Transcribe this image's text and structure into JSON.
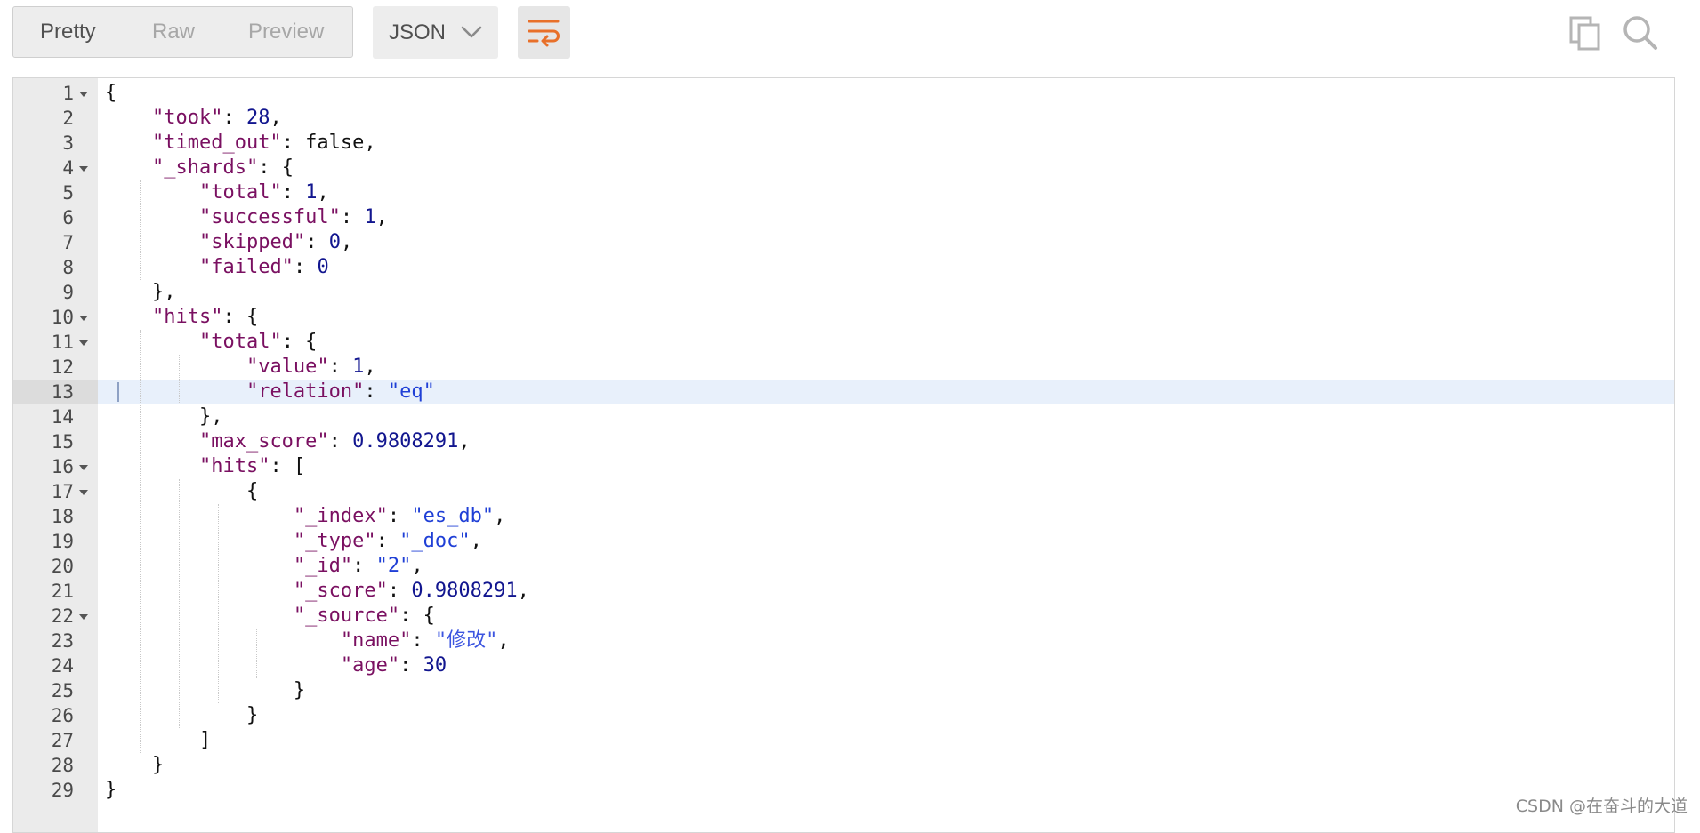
{
  "toolbar": {
    "tabs": [
      {
        "label": "Pretty",
        "active": true
      },
      {
        "label": "Raw",
        "active": false
      },
      {
        "label": "Preview",
        "active": false
      }
    ],
    "format": {
      "selected": "JSON",
      "icon": "chevron-down-icon"
    },
    "wrap_icon": "wrap-lines-icon",
    "copy_icon": "copy-icon",
    "search_icon": "search-icon",
    "accent_color": "#e8702a"
  },
  "editor": {
    "active_line": 13,
    "lines": [
      {
        "n": "1",
        "fold": true,
        "code": [
          [
            "p",
            "{"
          ]
        ]
      },
      {
        "n": "2",
        "fold": false,
        "code": [
          [
            "p",
            "    "
          ],
          [
            "k",
            "\"took\""
          ],
          [
            "p",
            ": "
          ],
          [
            "n",
            "28"
          ],
          [
            "p",
            ","
          ]
        ]
      },
      {
        "n": "3",
        "fold": false,
        "code": [
          [
            "p",
            "    "
          ],
          [
            "k",
            "\"timed_out\""
          ],
          [
            "p",
            ": false,"
          ]
        ]
      },
      {
        "n": "4",
        "fold": true,
        "code": [
          [
            "p",
            "    "
          ],
          [
            "k",
            "\"_shards\""
          ],
          [
            "p",
            ": {"
          ]
        ]
      },
      {
        "n": "5",
        "fold": false,
        "code": [
          [
            "p",
            "        "
          ],
          [
            "k",
            "\"total\""
          ],
          [
            "p",
            ": "
          ],
          [
            "n",
            "1"
          ],
          [
            "p",
            ","
          ]
        ]
      },
      {
        "n": "6",
        "fold": false,
        "code": [
          [
            "p",
            "        "
          ],
          [
            "k",
            "\"successful\""
          ],
          [
            "p",
            ": "
          ],
          [
            "n",
            "1"
          ],
          [
            "p",
            ","
          ]
        ]
      },
      {
        "n": "7",
        "fold": false,
        "code": [
          [
            "p",
            "        "
          ],
          [
            "k",
            "\"skipped\""
          ],
          [
            "p",
            ": "
          ],
          [
            "n",
            "0"
          ],
          [
            "p",
            ","
          ]
        ]
      },
      {
        "n": "8",
        "fold": false,
        "code": [
          [
            "p",
            "        "
          ],
          [
            "k",
            "\"failed\""
          ],
          [
            "p",
            ": "
          ],
          [
            "n",
            "0"
          ]
        ]
      },
      {
        "n": "9",
        "fold": false,
        "code": [
          [
            "p",
            "    },"
          ]
        ]
      },
      {
        "n": "10",
        "fold": true,
        "code": [
          [
            "p",
            "    "
          ],
          [
            "k",
            "\"hits\""
          ],
          [
            "p",
            ": {"
          ]
        ]
      },
      {
        "n": "11",
        "fold": true,
        "code": [
          [
            "p",
            "        "
          ],
          [
            "k",
            "\"total\""
          ],
          [
            "p",
            ": {"
          ]
        ]
      },
      {
        "n": "12",
        "fold": false,
        "code": [
          [
            "p",
            "            "
          ],
          [
            "k",
            "\"value\""
          ],
          [
            "p",
            ": "
          ],
          [
            "n",
            "1"
          ],
          [
            "p",
            ","
          ]
        ]
      },
      {
        "n": "13",
        "fold": false,
        "code": [
          [
            "p",
            "            "
          ],
          [
            "k",
            "\"relation\""
          ],
          [
            "p",
            ": "
          ],
          [
            "s",
            "\"eq\""
          ]
        ]
      },
      {
        "n": "14",
        "fold": false,
        "code": [
          [
            "p",
            "        },"
          ]
        ]
      },
      {
        "n": "15",
        "fold": false,
        "code": [
          [
            "p",
            "        "
          ],
          [
            "k",
            "\"max_score\""
          ],
          [
            "p",
            ": "
          ],
          [
            "n",
            "0.9808291"
          ],
          [
            "p",
            ","
          ]
        ]
      },
      {
        "n": "16",
        "fold": true,
        "code": [
          [
            "p",
            "        "
          ],
          [
            "k",
            "\"hits\""
          ],
          [
            "p",
            ": ["
          ]
        ]
      },
      {
        "n": "17",
        "fold": true,
        "code": [
          [
            "p",
            "            {"
          ]
        ]
      },
      {
        "n": "18",
        "fold": false,
        "code": [
          [
            "p",
            "                "
          ],
          [
            "k",
            "\"_index\""
          ],
          [
            "p",
            ": "
          ],
          [
            "s",
            "\"es_db\""
          ],
          [
            "p",
            ","
          ]
        ]
      },
      {
        "n": "19",
        "fold": false,
        "code": [
          [
            "p",
            "                "
          ],
          [
            "k",
            "\"_type\""
          ],
          [
            "p",
            ": "
          ],
          [
            "s",
            "\"_doc\""
          ],
          [
            "p",
            ","
          ]
        ]
      },
      {
        "n": "20",
        "fold": false,
        "code": [
          [
            "p",
            "                "
          ],
          [
            "k",
            "\"_id\""
          ],
          [
            "p",
            ": "
          ],
          [
            "s",
            "\"2\""
          ],
          [
            "p",
            ","
          ]
        ]
      },
      {
        "n": "21",
        "fold": false,
        "code": [
          [
            "p",
            "                "
          ],
          [
            "k",
            "\"_score\""
          ],
          [
            "p",
            ": "
          ],
          [
            "n",
            "0.9808291"
          ],
          [
            "p",
            ","
          ]
        ]
      },
      {
        "n": "22",
        "fold": true,
        "code": [
          [
            "p",
            "                "
          ],
          [
            "k",
            "\"_source\""
          ],
          [
            "p",
            ": {"
          ]
        ]
      },
      {
        "n": "23",
        "fold": false,
        "code": [
          [
            "p",
            "                    "
          ],
          [
            "k",
            "\"name\""
          ],
          [
            "p",
            ": "
          ],
          [
            "c",
            "\"修改\""
          ],
          [
            "p",
            ","
          ]
        ]
      },
      {
        "n": "24",
        "fold": false,
        "code": [
          [
            "p",
            "                    "
          ],
          [
            "k",
            "\"age\""
          ],
          [
            "p",
            ": "
          ],
          [
            "n",
            "30"
          ]
        ]
      },
      {
        "n": "25",
        "fold": false,
        "code": [
          [
            "p",
            "                }"
          ]
        ]
      },
      {
        "n": "26",
        "fold": false,
        "code": [
          [
            "p",
            "            }"
          ]
        ]
      },
      {
        "n": "27",
        "fold": false,
        "code": [
          [
            "p",
            "        ]"
          ]
        ]
      },
      {
        "n": "28",
        "fold": false,
        "code": [
          [
            "p",
            "    }"
          ]
        ]
      },
      {
        "n": "29",
        "fold": false,
        "code": [
          [
            "p",
            "}"
          ]
        ]
      }
    ]
  },
  "watermark": "CSDN @在奋斗的大道"
}
